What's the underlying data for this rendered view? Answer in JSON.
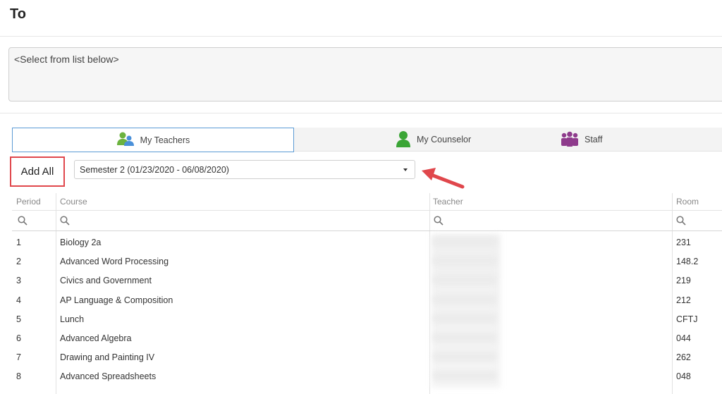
{
  "header": {
    "title": "To"
  },
  "recipients": {
    "placeholder": "<Select from list below>"
  },
  "tabs": [
    {
      "label": "My Teachers",
      "icon": "teachers-icon"
    },
    {
      "label": "My Counselor",
      "icon": "counselor-icon"
    },
    {
      "label": "Staff",
      "icon": "staff-icon"
    }
  ],
  "toolbar": {
    "add_all_label": "Add All",
    "semester_value": "Semester 2 (01/23/2020 - 06/08/2020)"
  },
  "table": {
    "columns": [
      "Period",
      "Course",
      "Teacher",
      "Room"
    ],
    "rows": [
      {
        "period": "1",
        "course": "Biology 2a",
        "teacher": "",
        "room": "231"
      },
      {
        "period": "2",
        "course": "Advanced Word Processing",
        "teacher": "",
        "room": "148.2"
      },
      {
        "period": "3",
        "course": "Civics and Government",
        "teacher": "",
        "room": "219"
      },
      {
        "period": "4",
        "course": "AP Language & Composition",
        "teacher": "",
        "room": "212"
      },
      {
        "period": "5",
        "course": "Lunch",
        "teacher": "",
        "room": "CFTJ"
      },
      {
        "period": "6",
        "course": "Advanced Algebra",
        "teacher": "",
        "room": "044"
      },
      {
        "period": "7",
        "course": "Drawing and Painting IV",
        "teacher": "",
        "room": "262"
      },
      {
        "period": "8",
        "course": "Advanced Spreadsheets",
        "teacher": "",
        "room": "048"
      }
    ]
  },
  "colors": {
    "accent_border": "#5b9bd5",
    "highlight_red": "#e0474c",
    "counselor_green": "#3aa535",
    "staff_purple": "#8e3b8c",
    "teachers_blue": "#4a90d9"
  }
}
